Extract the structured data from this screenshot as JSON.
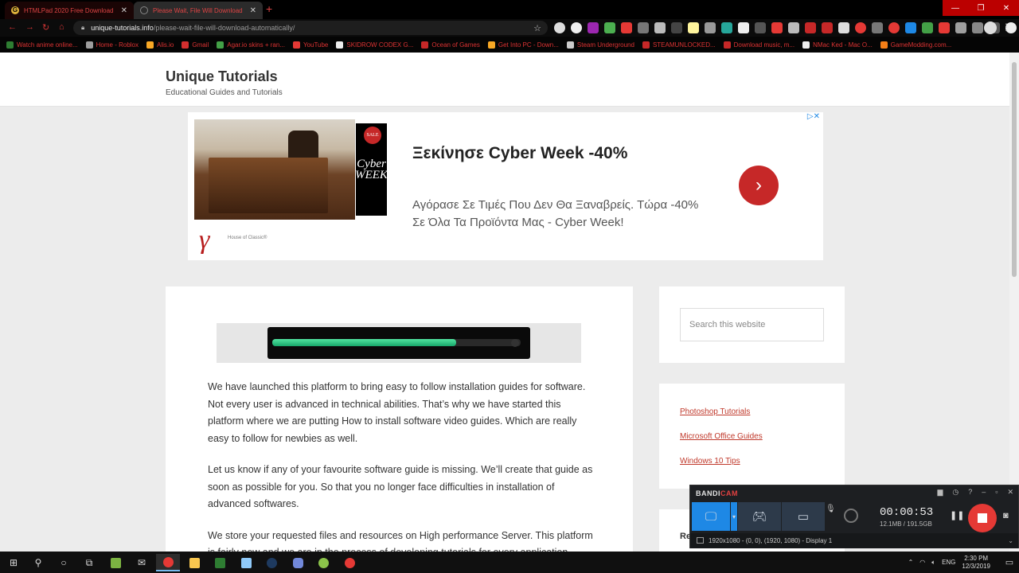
{
  "browser": {
    "tabs": [
      {
        "title": "HTMLPad 2020 Free Download",
        "favicon": "G",
        "favicon_color": "#e0b43c"
      },
      {
        "title": "Please Wait, File Will Download",
        "favicon": "globe",
        "favicon_color": "#888888"
      }
    ],
    "url_host": "unique-tutorials.info",
    "url_path": "/please-wait-file-will-download-automatically/",
    "bookmarks": [
      {
        "label": "Watch anime online...",
        "color": "#2e7d32"
      },
      {
        "label": "Home - Roblox",
        "color": "#9e9e9e"
      },
      {
        "label": "Alis.io",
        "color": "#f9a825"
      },
      {
        "label": "Gmail",
        "color": "#d32f2f"
      },
      {
        "label": "Agar.io skins + ran...",
        "color": "#43a047"
      },
      {
        "label": "YouTube",
        "color": "#e53935"
      },
      {
        "label": "SKIDROW CODEX G...",
        "color": "#eeeeee"
      },
      {
        "label": "Ocean of Games",
        "color": "#c62828"
      },
      {
        "label": "Get Into PC - Down...",
        "color": "#f9a825"
      },
      {
        "label": "Steam Underground",
        "color": "#cccccc"
      },
      {
        "label": "STEAMUNLOCKED...",
        "color": "#c62828"
      },
      {
        "label": "Download music, m...",
        "color": "#c62828"
      },
      {
        "label": "NMac Ked - Mac O...",
        "color": "#eeeeee"
      },
      {
        "label": "GameModding.com...",
        "color": "#f57f17"
      }
    ]
  },
  "site": {
    "title": "Unique Tutorials",
    "description": "Educational Guides and Tutorials"
  },
  "ad": {
    "badge_text": "Cyber WEEK",
    "badge_sale": "SALE",
    "logo": "γ",
    "brand": "House of Classic®",
    "headline": "Ξεκίνησε Cyber Week -40%",
    "body": "Αγόρασε Σε Τιμές Που Δεν Θα Ξαναβρείς. Τώρα -40% Σε Όλα Τα Προϊόντα Μας - Cyber Week!",
    "choices": "▷✕"
  },
  "video": {
    "progress": 0.74
  },
  "article": {
    "paragraphs": [
      "We have launched this platform to bring easy to follow installation guides for software. Not every user is advanced in technical abilities. That’s why we have started this platform where we are putting How to install software video guides. Which are really easy to follow for newbies as well.",
      "Let us know if any of your favourite software guide is missing. We’ll create that guide as soon as possible for you. So that you no longer face difficulties in installation of advanced softwares.",
      "We store your requested files and resources on High performance Server. This platform is fairly new and we are in the process of developing tutorials for every application."
    ]
  },
  "sidebar": {
    "search_placeholder": "Search this website",
    "links": [
      "Photoshop Tutorials",
      "Microsoft Office Guides",
      "Windows 10 Tips"
    ],
    "recent_heading": "Re"
  },
  "bandicam": {
    "brand_a": "BANDI",
    "brand_b": "CAM",
    "timer": "00:00:53",
    "size": "12.1MB / 191.5GB",
    "status": "1920x1080 - (0, 0), (1920, 1080) - Display 1"
  },
  "taskbar": {
    "lang": "ENG",
    "time": "2:30 PM",
    "date": "12/3/2019"
  }
}
